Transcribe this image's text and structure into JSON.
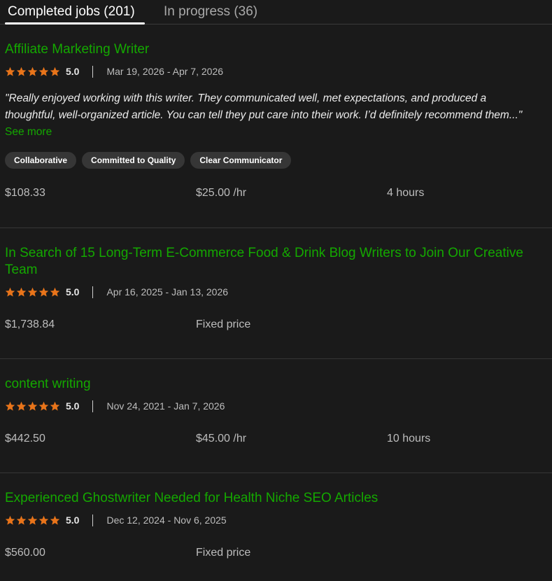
{
  "tabs": [
    {
      "label": "Completed jobs (201)",
      "active": true
    },
    {
      "label": "In progress (36)",
      "active": false
    }
  ],
  "colors": {
    "background": "#1a1a1a",
    "link_green": "#14a800",
    "star_orange": "#e8741a",
    "chip_bg": "#363636"
  },
  "jobs": [
    {
      "title": "Affiliate Marketing Writer",
      "rating_value": 5,
      "rating_text": "5.0",
      "dates": "Mar 19, 2026 - Apr 7, 2026",
      "feedback_line1": "\"Really enjoyed working with this writer. They communicated well, met expectations, and produced a",
      "feedback_line2": "thoughtful, well-organized article. You can tell they put care into their work. I’d definitely recommend them...\"",
      "see_more": "See more",
      "tags": [
        "Collaborative",
        "Committed to Quality",
        "Clear Communicator"
      ],
      "earned": "$108.33",
      "rate": "$25.00 /hr",
      "hours": "4 hours"
    },
    {
      "title": "In Search of 15 Long-Term E-Commerce Food & Drink Blog Writers to Join Our Creative Team",
      "rating_value": 5,
      "rating_text": "5.0",
      "dates": "Apr 16, 2025 - Jan 13, 2026",
      "earned": "$1,738.84",
      "rate": "Fixed price"
    },
    {
      "title": "content writing",
      "rating_value": 5,
      "rating_text": "5.0",
      "dates": "Nov 24, 2021 - Jan 7, 2026",
      "earned": "$442.50",
      "rate": "$45.00 /hr",
      "hours": "10 hours"
    },
    {
      "title": "Experienced Ghostwriter Needed for Health Niche SEO Articles",
      "rating_value": 5,
      "rating_text": "5.0",
      "dates": "Dec 12, 2024 - Nov 6, 2025",
      "earned": "$560.00",
      "rate": "Fixed price"
    }
  ]
}
